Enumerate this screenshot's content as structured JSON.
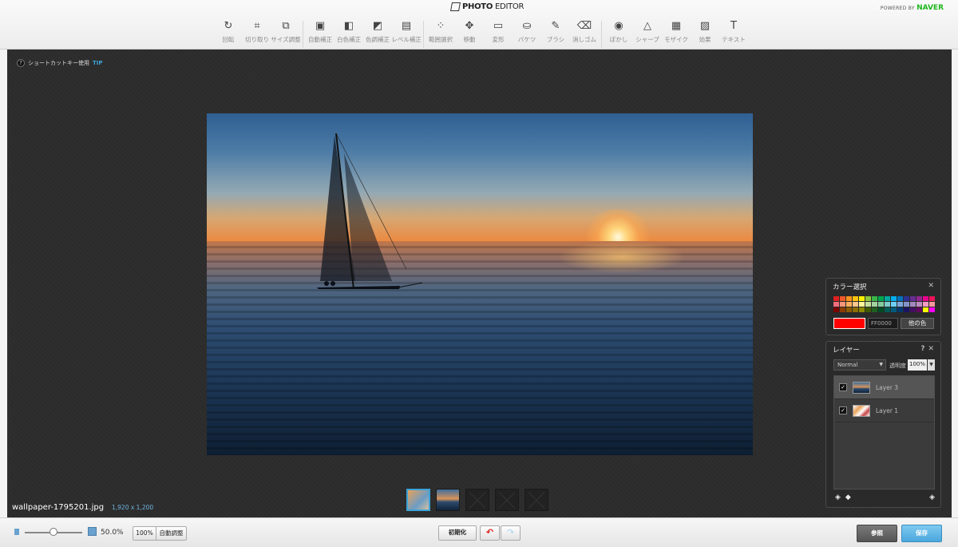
{
  "header": {
    "logo_bold": "PHOTO",
    "logo_light": "EDITOR",
    "powered_by": "POWERED BY",
    "brand": "NAVER"
  },
  "tools": [
    {
      "label": "回転",
      "icon": "rotate-icon",
      "glyph": "↻"
    },
    {
      "label": "切り取り",
      "icon": "crop-icon",
      "glyph": "⌗"
    },
    {
      "label": "サイズ調整",
      "icon": "resize-icon",
      "glyph": "⧉"
    },
    {
      "label": "自動補正",
      "icon": "auto-correct-icon",
      "glyph": "▣"
    },
    {
      "label": "白色補正",
      "icon": "white-balance-icon",
      "glyph": "◧"
    },
    {
      "label": "色調補正",
      "icon": "color-correct-icon",
      "glyph": "◩"
    },
    {
      "label": "レベル補正",
      "icon": "level-correct-icon",
      "glyph": "▤"
    },
    {
      "label": "範囲選択",
      "icon": "magic-wand-icon",
      "glyph": "⁘"
    },
    {
      "label": "移動",
      "icon": "move-icon",
      "glyph": "✥"
    },
    {
      "label": "変形",
      "icon": "transform-icon",
      "glyph": "▭"
    },
    {
      "label": "バケツ",
      "icon": "bucket-icon",
      "glyph": "⛀"
    },
    {
      "label": "ブラシ",
      "icon": "brush-icon",
      "glyph": "✎"
    },
    {
      "label": "消しゴム",
      "icon": "eraser-icon",
      "glyph": "⌫"
    },
    {
      "label": "ぼかし",
      "icon": "blur-icon",
      "glyph": "◉"
    },
    {
      "label": "シャープ",
      "icon": "sharpen-icon",
      "glyph": "△"
    },
    {
      "label": "モザイク",
      "icon": "mosaic-icon",
      "glyph": "▦"
    },
    {
      "label": "効果",
      "icon": "effect-icon",
      "glyph": "▨"
    },
    {
      "label": "テキスト",
      "icon": "text-icon",
      "glyph": "T"
    }
  ],
  "workspace": {
    "tip_text": "ショートカットキー使用",
    "tip_tag": "TIP",
    "filename": "wallpaper-1795201.jpg",
    "dimensions": "1,920 x 1,200"
  },
  "color_panel": {
    "title": "カラー選択",
    "hex_value": "FF0000",
    "current_color": "#ff0000",
    "other_color_label": "他の色",
    "palette": [
      "#e02020",
      "#f05a28",
      "#f7941d",
      "#ffc20e",
      "#fff200",
      "#8dc63f",
      "#39b54a",
      "#00a651",
      "#00a99d",
      "#00aeef",
      "#0072bc",
      "#2e3192",
      "#662d91",
      "#92278f",
      "#ec008c",
      "#ed145b",
      "#f26d7d",
      "#f69679",
      "#fbaf5d",
      "#fdc68a",
      "#fff799",
      "#c4df9b",
      "#a3d39c",
      "#82ca9c",
      "#7accc8",
      "#6dcff6",
      "#7da7d9",
      "#8393ca",
      "#a187be",
      "#bd8cbf",
      "#f49ac1",
      "#f5989d",
      "#7d0000",
      "#8c3b00",
      "#8c5b00",
      "#8c6d00",
      "#8c8a00",
      "#3e5b00",
      "#1f5f1f",
      "#004b24",
      "#005b55",
      "#005b7f",
      "#003870",
      "#1b1464",
      "#440e62",
      "#630460",
      "#ffff00",
      "#ff00ff"
    ]
  },
  "layer_panel": {
    "title": "レイヤー",
    "help": "?",
    "blend_mode": "Normal",
    "opacity_label": "透明度",
    "opacity_value": "100%",
    "layers": [
      {
        "name": "Layer 3",
        "selected": true
      },
      {
        "name": "Layer 1",
        "selected": false
      }
    ]
  },
  "bottom": {
    "zoom_value": "50.0%",
    "zoom_fraction": 0.5,
    "btn_100": "100%",
    "btn_auto": "自動調整",
    "btn_init": "初期化",
    "btn_browse": "参照",
    "btn_save": "保存"
  }
}
